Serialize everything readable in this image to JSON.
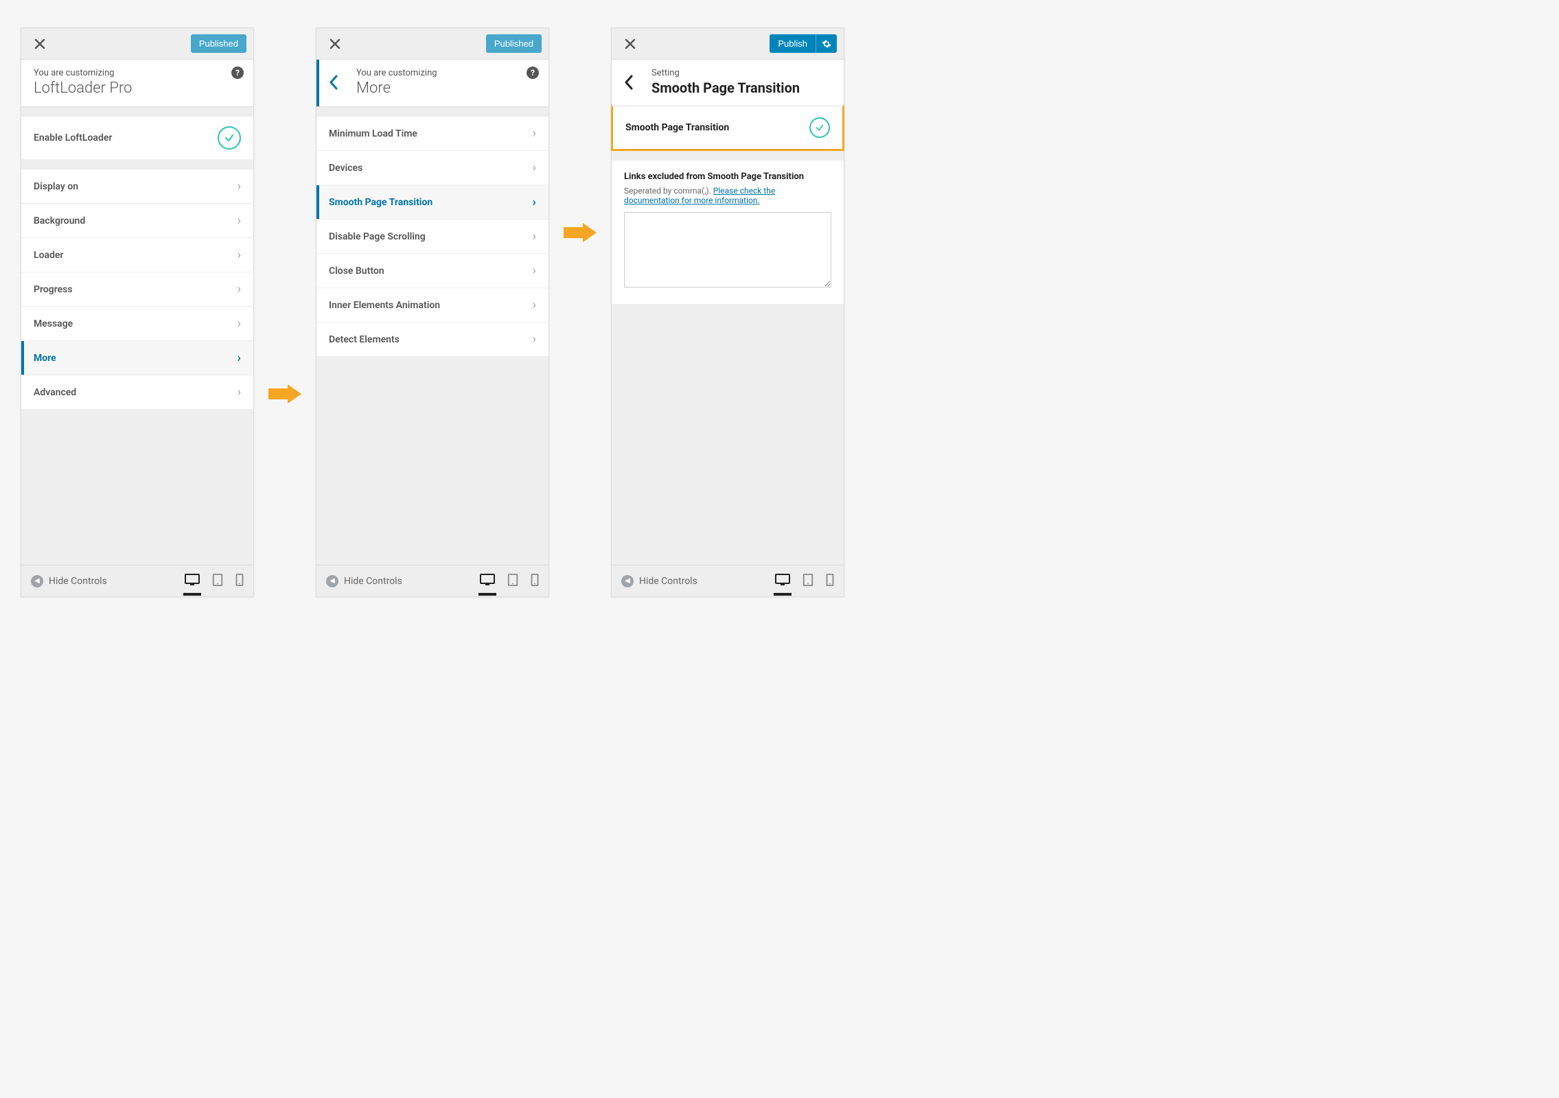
{
  "colors": {
    "accent": "#0073aa",
    "teal": "#2bc4b6",
    "highlight": "#f5a623"
  },
  "panel1": {
    "published_label": "Published",
    "eyebrow": "You are customizing",
    "title": "LoftLoader Pro",
    "enable_label": "Enable LoftLoader",
    "menu": [
      {
        "label": "Display on",
        "active": false
      },
      {
        "label": "Background",
        "active": false
      },
      {
        "label": "Loader",
        "active": false
      },
      {
        "label": "Progress",
        "active": false
      },
      {
        "label": "Message",
        "active": false
      },
      {
        "label": "More",
        "active": true
      },
      {
        "label": "Advanced",
        "active": false
      }
    ],
    "hide_controls": "Hide Controls"
  },
  "panel2": {
    "published_label": "Published",
    "eyebrow": "You are customizing",
    "title": "More",
    "menu": [
      {
        "label": "Minimum Load Time",
        "active": false
      },
      {
        "label": "Devices",
        "active": false
      },
      {
        "label": "Smooth Page Transition",
        "active": true
      },
      {
        "label": "Disable Page Scrolling",
        "active": false
      },
      {
        "label": "Close Button",
        "active": false
      },
      {
        "label": "Inner Elements Animation",
        "active": false
      },
      {
        "label": "Detect Elements",
        "active": false
      }
    ],
    "hide_controls": "Hide Controls"
  },
  "panel3": {
    "publish_label": "Publish",
    "eyebrow": "Setting",
    "title": "Smooth Page Transition",
    "toggle_label": "Smooth Page Transition",
    "excluded_heading": "Links excluded from Smooth Page Transition",
    "excluded_desc_prefix": "Seperated by comma(,). ",
    "excluded_link_text": "Please check the documentation for more information.",
    "textarea_value": "",
    "hide_controls": "Hide Controls"
  }
}
